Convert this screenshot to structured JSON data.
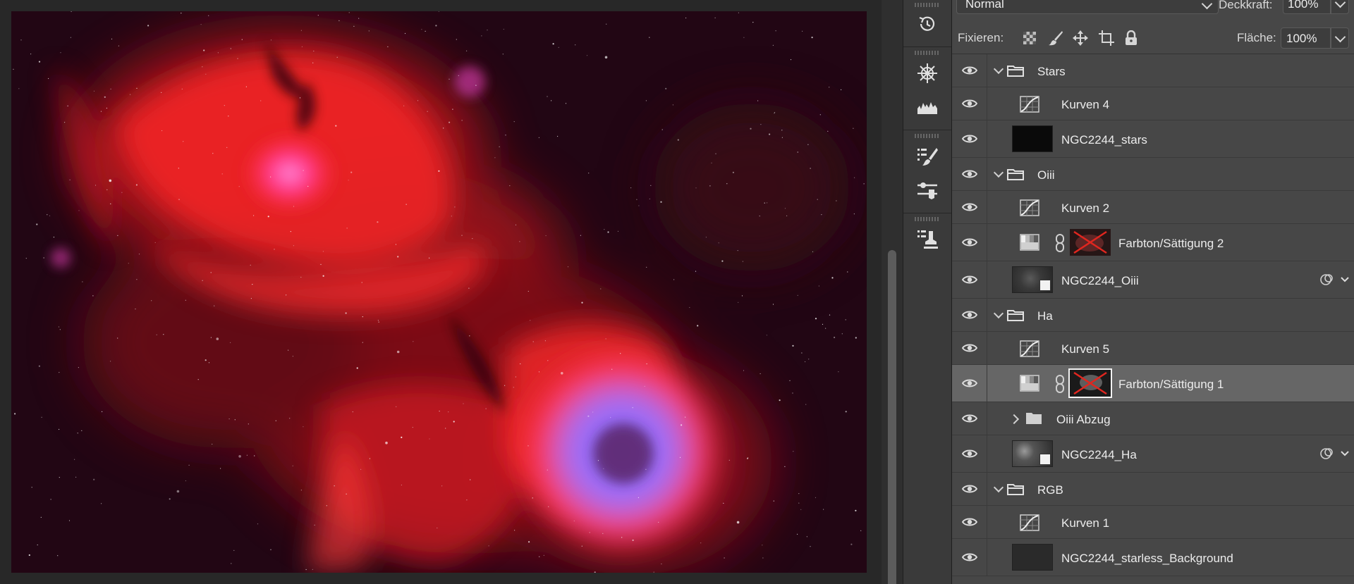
{
  "layers_panel": {
    "blend_mode": "Normal",
    "opacity_label": "Deckkraft:",
    "opacity_value": "100%",
    "lock_label": "Fixieren:",
    "fill_label": "Fläche:",
    "fill_value": "100%",
    "layers": [
      {
        "name": "Stars",
        "kind": "group",
        "expanded": true,
        "indent": 0
      },
      {
        "name": "Kurven 4",
        "kind": "curves",
        "indent": 1
      },
      {
        "name": "NGC2244_stars",
        "kind": "pixel",
        "indent": 1
      },
      {
        "name": "Oiii",
        "kind": "group",
        "expanded": true,
        "indent": 0
      },
      {
        "name": "Kurven 2",
        "kind": "curves",
        "indent": 1
      },
      {
        "name": "Farbton/Sättigung 2",
        "kind": "hue-saturation",
        "indent": 1
      },
      {
        "name": "NGC2244_Oiii",
        "kind": "smart-object",
        "indent": 1
      },
      {
        "name": "Ha",
        "kind": "group",
        "expanded": true,
        "indent": 0
      },
      {
        "name": "Kurven 5",
        "kind": "curves",
        "indent": 1
      },
      {
        "name": "Farbton/Sättigung 1",
        "kind": "hue-saturation",
        "indent": 1,
        "selected": true
      },
      {
        "name": "Oiii Abzug",
        "kind": "group",
        "expanded": false,
        "indent": 1
      },
      {
        "name": "NGC2244_Ha",
        "kind": "smart-object",
        "indent": 1
      },
      {
        "name": "RGB",
        "kind": "group",
        "expanded": true,
        "indent": 0
      },
      {
        "name": "Kurven 1",
        "kind": "curves",
        "indent": 1
      },
      {
        "name": "NGC2244_starless_Background",
        "kind": "pixel",
        "indent": 1
      }
    ]
  },
  "tool_strip": {
    "icons": [
      "history-icon",
      "navigator-icon",
      "histogram-icon",
      "brush-settings-icon",
      "adjustments-icon",
      "clone-source-icon"
    ]
  },
  "colors": {
    "panel_bg": "#474747",
    "selected_row": "#666666",
    "canvas_bg": "#282828",
    "nebula_red": "#e8212a",
    "nebula_blue": "#8a6cff"
  }
}
